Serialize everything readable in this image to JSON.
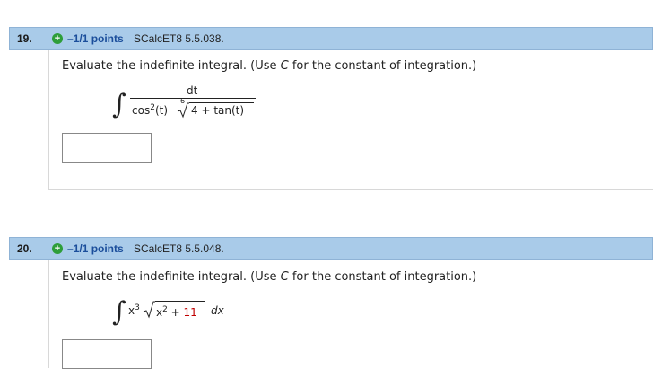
{
  "questions": [
    {
      "number": "19.",
      "points": "–1/1 points",
      "source": "SCalcET8 5.5.038.",
      "prompt_pre": "Evaluate the indefinite integral. (Use ",
      "prompt_var": "C",
      "prompt_post": " for the constant of integration.)",
      "numerator": "dt",
      "denominator_cos": "cos",
      "denominator_exp": "2",
      "denominator_arg": "(t)",
      "root_index": "6",
      "radicand": "4 + tan(t)"
    },
    {
      "number": "20.",
      "points": "–1/1 points",
      "source": "SCalcET8 5.5.048.",
      "prompt_pre": "Evaluate the indefinite integral. (Use ",
      "prompt_var": "C",
      "prompt_post": " for the constant of integration.)",
      "x_base": "x",
      "x_exp": "3",
      "rad_base": "x",
      "rad_exp": "2",
      "rad_plus": " + ",
      "rad_const": "11",
      "differential": "dx"
    }
  ]
}
